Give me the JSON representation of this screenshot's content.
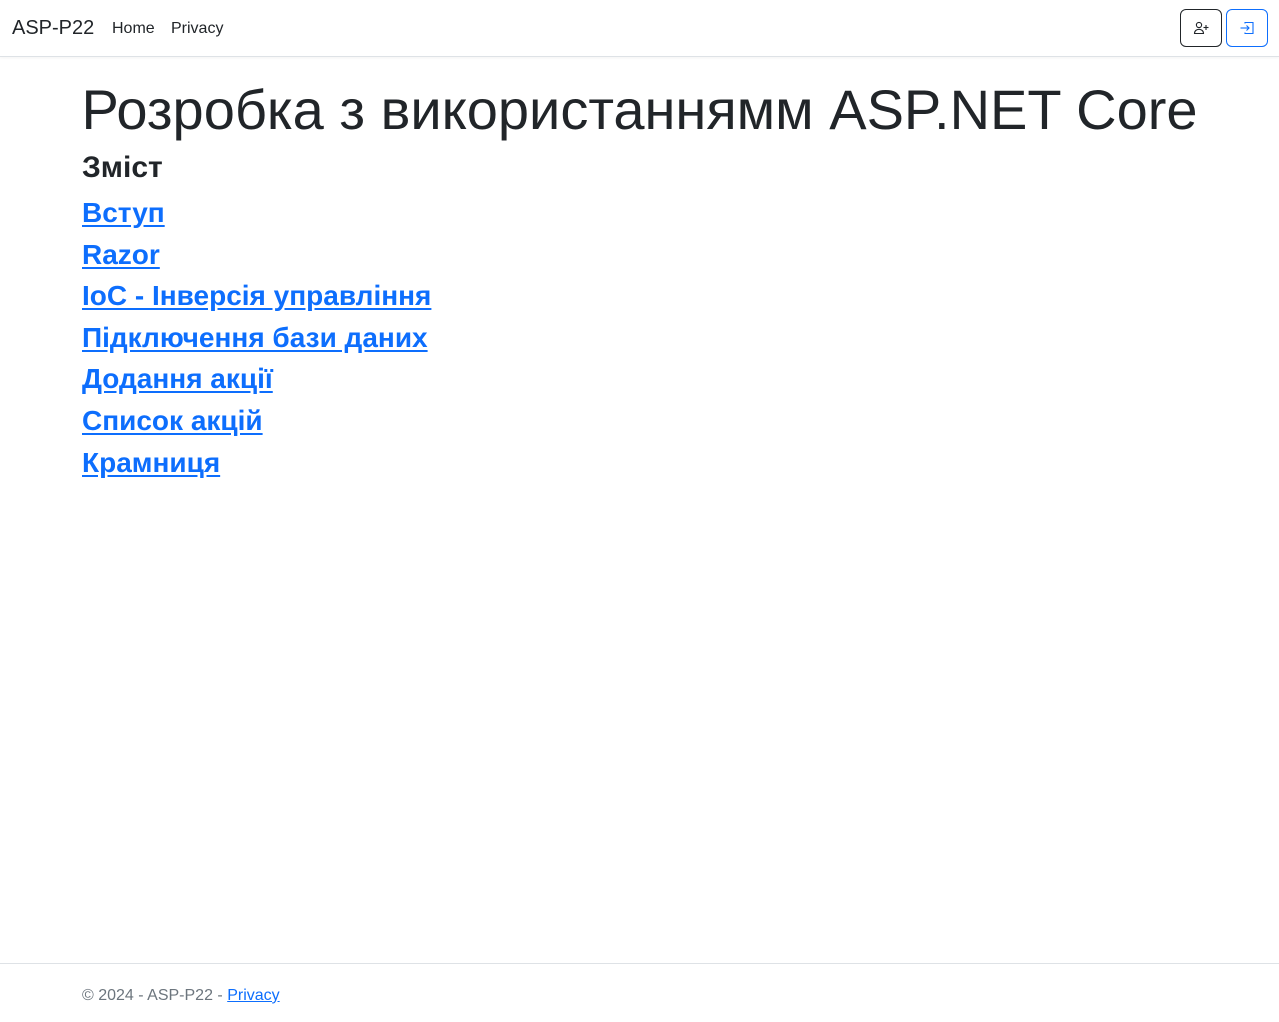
{
  "navbar": {
    "brand": "ASP-P22",
    "links": [
      {
        "label": "Home"
      },
      {
        "label": "Privacy"
      }
    ],
    "buttons": [
      {
        "icon": "person-plus-icon",
        "style": "outline-dark"
      },
      {
        "icon": "box-arrow-in-right-icon",
        "style": "outline-primary"
      }
    ]
  },
  "main": {
    "title": "Розробка з використаннямм ASP.NET Core",
    "toc_heading": "Зміст",
    "toc_items": [
      {
        "label": "Вступ"
      },
      {
        "label": "Razor"
      },
      {
        "label": "IoC - Інверсія управління"
      },
      {
        "label": "Підключення бази даних"
      },
      {
        "label": "Додання акції"
      },
      {
        "label": "Список акцій"
      },
      {
        "label": "Крамниця"
      }
    ]
  },
  "footer": {
    "text": "© 2024 - ASP-P22 - ",
    "privacy_label": "Privacy"
  },
  "colors": {
    "link": "#0d6efd",
    "text": "#212529",
    "muted": "#6c757d",
    "border": "#dee2e6"
  }
}
